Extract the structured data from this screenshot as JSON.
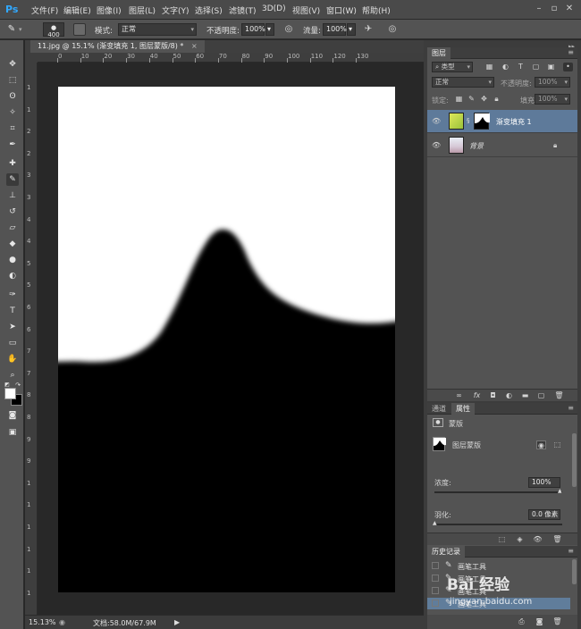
{
  "app": {
    "logo": "Ps"
  },
  "menu": [
    "文件(F)",
    "编辑(E)",
    "图像(I)",
    "图层(L)",
    "文字(Y)",
    "选择(S)",
    "滤镜(T)",
    "3D(D)",
    "视图(V)",
    "窗口(W)",
    "帮助(H)"
  ],
  "options": {
    "brush_size": "400",
    "mode_label": "模式:",
    "mode_value": "正常",
    "opacity_label": "不透明度:",
    "opacity_value": "100%",
    "flow_label": "流量:",
    "flow_value": "100%"
  },
  "document": {
    "tab_title": "11.jpg @ 15.1% (渐变填充 1, 图层蒙版/8) *",
    "ruler_h": [
      "0",
      "10",
      "20",
      "30",
      "40",
      "50",
      "60",
      "70",
      "80",
      "90",
      "100",
      "110",
      "120",
      "130"
    ],
    "ruler_v": [
      "1",
      "1",
      "2",
      "2",
      "3",
      "3",
      "4",
      "4",
      "5",
      "5",
      "6",
      "6",
      "7",
      "7",
      "8",
      "8",
      "9",
      "9",
      "1",
      "1",
      "1",
      "1",
      "1",
      "1"
    ],
    "mask": {
      "background_color": "#000000",
      "revealed_color": "#ffffff"
    }
  },
  "status": {
    "zoom": "15.13%",
    "doc_size": "文档:58.0M/67.9M"
  },
  "layers_panel": {
    "tab": "图层",
    "filter_kind": "类型",
    "blend_mode": "正常",
    "opacity_label": "不透明度:",
    "opacity_value": "100%",
    "lock_label": "锁定:",
    "fill_label": "填充:",
    "fill_value": "100%",
    "layers": [
      {
        "name": "渐变填充 1",
        "selected": true
      },
      {
        "name": "背景",
        "selected": false
      }
    ]
  },
  "properties_panel": {
    "tabs": [
      "通道",
      "属性"
    ],
    "section_title": "蒙版",
    "mask_type": "图层蒙版",
    "density_label": "浓度:",
    "density_value": "100%",
    "feather_label": "羽化:",
    "feather_value": "0.0 像素"
  },
  "history_panel": {
    "tab": "历史记录",
    "items": [
      "画笔工具",
      "画笔工具",
      "画笔工具",
      "画笔工具"
    ]
  },
  "watermark": {
    "main": "Bai 经验",
    "sub": "jingyan.baidu.com"
  }
}
